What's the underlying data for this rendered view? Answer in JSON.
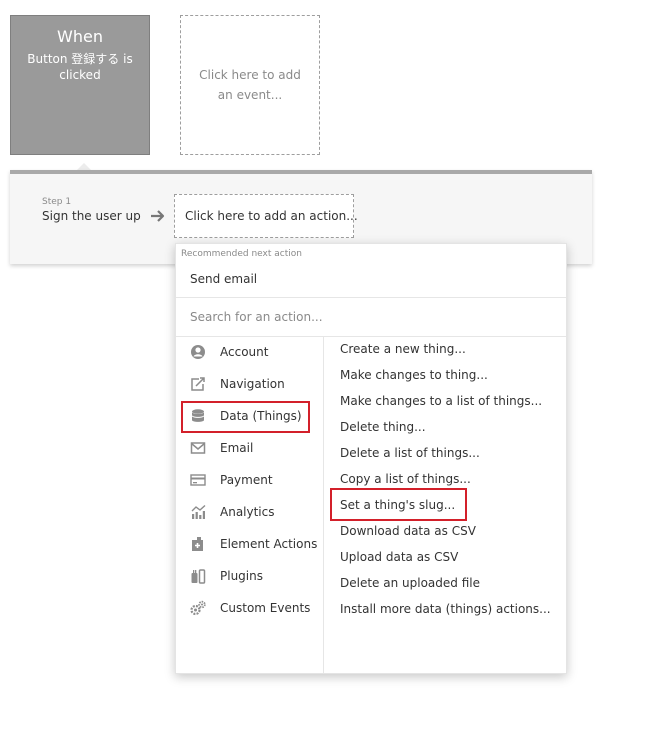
{
  "event": {
    "title": "When",
    "description": "Button 登録する is clicked",
    "add_event_label": "Click here to add an event..."
  },
  "step": {
    "label": "Step 1",
    "name": "Sign the user up",
    "add_action_label": "Click here to add an action..."
  },
  "menu": {
    "recommended_label": "Recommended next action",
    "recommended_item": "Send email",
    "search_placeholder": "Search for an action...",
    "categories": [
      {
        "label": "Account",
        "icon": "account-icon"
      },
      {
        "label": "Navigation",
        "icon": "navigation-icon"
      },
      {
        "label": "Data (Things)",
        "icon": "database-icon"
      },
      {
        "label": "Email",
        "icon": "email-icon"
      },
      {
        "label": "Payment",
        "icon": "payment-icon"
      },
      {
        "label": "Analytics",
        "icon": "analytics-icon"
      },
      {
        "label": "Element Actions",
        "icon": "element-actions-icon"
      },
      {
        "label": "Plugins",
        "icon": "plugins-icon"
      },
      {
        "label": "Custom Events",
        "icon": "custom-events-icon"
      }
    ],
    "actions": [
      "Create a new thing...",
      "Make changes to thing...",
      "Make changes to a list of things...",
      "Delete thing...",
      "Delete a list of things...",
      "Copy a list of things...",
      "Set a thing's slug...",
      "Download data as CSV",
      "Upload data as CSV",
      "Delete an uploaded file",
      "Install more data (things) actions..."
    ]
  },
  "colors": {
    "when_card_bg": "#9a9a9a",
    "highlight": "#d3202a",
    "icon": "#8c8c8c"
  }
}
